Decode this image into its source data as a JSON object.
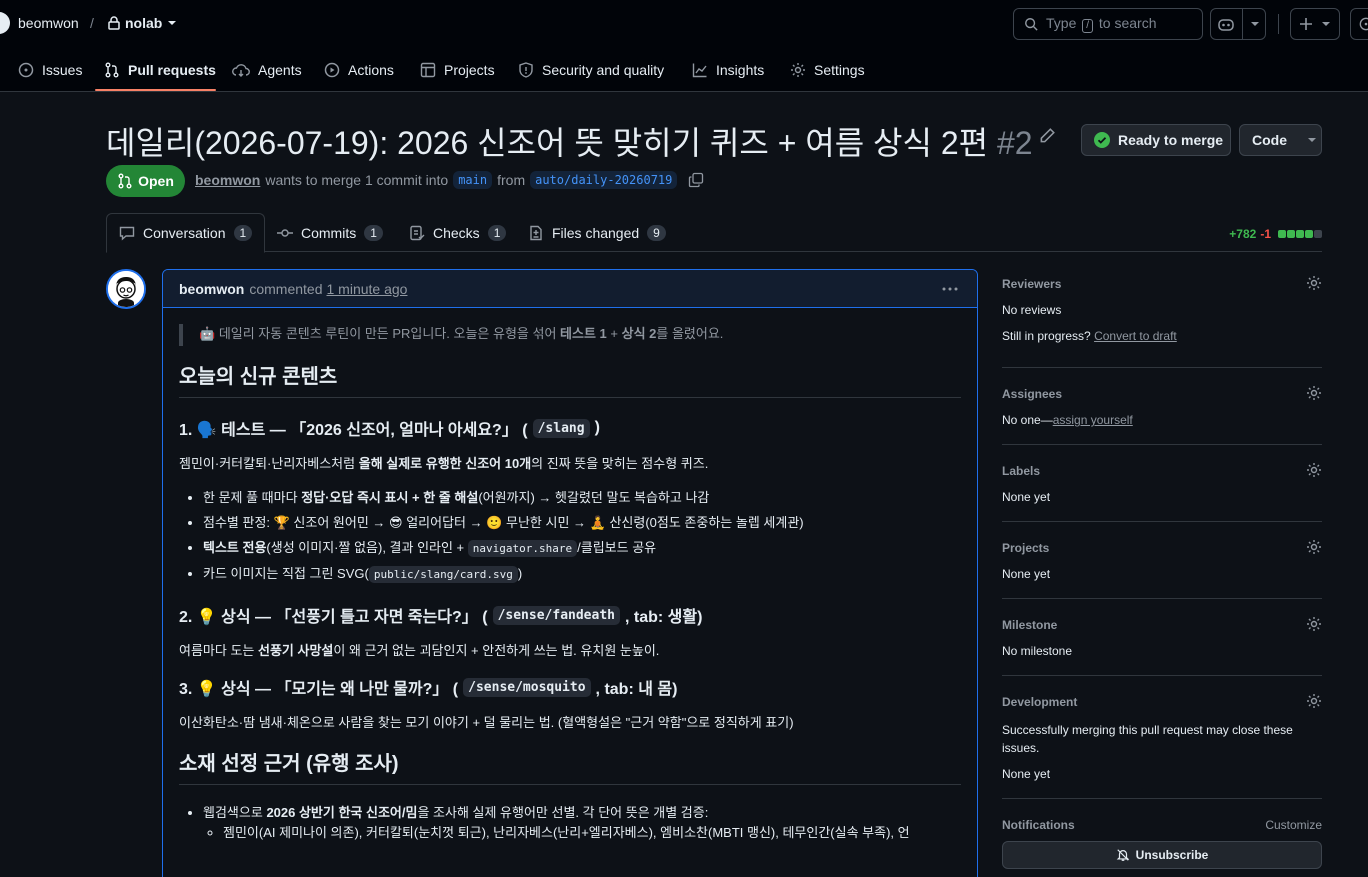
{
  "header": {
    "owner": "beomwon",
    "separator": "/",
    "repo": "nolab",
    "search_prefix": "Type",
    "search_key": "/",
    "search_suffix": "to search"
  },
  "nav": [
    {
      "label": "Issues",
      "icon": "issue-icon"
    },
    {
      "label": "Pull requests",
      "icon": "pull-request-icon",
      "active": true
    },
    {
      "label": "Agents",
      "icon": "agents-icon"
    },
    {
      "label": "Actions",
      "icon": "play-icon"
    },
    {
      "label": "Projects",
      "icon": "table-icon"
    },
    {
      "label": "Security and quality",
      "icon": "shield-icon"
    },
    {
      "label": "Insights",
      "icon": "graph-icon"
    },
    {
      "label": "Settings",
      "icon": "gear-icon"
    }
  ],
  "pr": {
    "title": "데일리(2026-07-19): 2026 신조어 뜻 맞히기 퀴즈 + 여름 상식 2편",
    "number": "#2",
    "state": "Open",
    "author": "beomwon",
    "meta_text": "wants to merge 1 commit into",
    "base": "main",
    "from": "from",
    "head": "auto/daily-20260719",
    "merge_label": "Ready to merge",
    "code_label": "Code"
  },
  "tabs": [
    {
      "label": "Conversation",
      "count": "1"
    },
    {
      "label": "Commits",
      "count": "1"
    },
    {
      "label": "Checks",
      "count": "1"
    },
    {
      "label": "Files changed",
      "count": "9"
    }
  ],
  "diffstat": {
    "additions": "+782",
    "deletions": "-1"
  },
  "comment": {
    "author": "beomwon",
    "action": "commented",
    "time": "1 minute ago",
    "quote_emoji": "🤖",
    "quote_a": "데일리 자동 콘텐츠 루틴이 만든 PR입니다. 오늘은 유형을 섞어",
    "quote_b": "테스트 1",
    "quote_c": "+",
    "quote_d": "상식 2",
    "quote_e": "를 올렸어요.",
    "h2_new": "오늘의 신규 콘텐츠",
    "s1": {
      "title_a": "1. 🗣️ 테스트 — 「2026 신조어, 얼마나 아세요?」 (",
      "code": "/slang",
      "title_b": ")",
      "p_a": "젬민이·커터칼퇴·난리자베스처럼",
      "p_b": "올해 실제로 유행한 신조어 10개",
      "p_c": "의 진짜 뜻을 맞히는 점수형 퀴즈.",
      "li1_a": "한 문제 풀 때마다",
      "li1_b": "정답·오답 즉시 표시 + 한 줄 해설",
      "li1_c": "(어원까지) → 헷갈렸던 말도 복습하고 나감",
      "li2": "점수별 판정: 🏆 신조어 원어민 → 😎 얼리어답터 → 🙂 무난한 시민 → 🧘 산신령(0점도 존중하는 놀렙 세계관)",
      "li3_a": "텍스트 전용",
      "li3_b": "(생성 이미지·짤 없음), 결과 인라인 +",
      "li3_code": "navigator.share",
      "li3_c": "/클립보드 공유",
      "li4_a": "카드 이미지는 직접 그린 SVG(",
      "li4_code": "public/slang/card.svg",
      "li4_b": ")"
    },
    "s2": {
      "title_a": "2. 💡 상식 — 「선풍기 틀고 자면 죽는다?」 (",
      "code": "/sense/fandeath",
      "title_b": ", tab: 생활)",
      "p_a": "여름마다 도는",
      "p_b": "선풍기 사망설",
      "p_c": "이 왜 근거 없는 괴담인지 + 안전하게 쓰는 법. 유치원 눈높이."
    },
    "s3": {
      "title_a": "3. 💡 상식 — 「모기는 왜 나만 물까?」 (",
      "code": "/sense/mosquito",
      "title_b": ", tab: 내 몸)",
      "p": "이산화탄소·땀 냄새·체온으로 사람을 찾는 모기 이야기 + 덜 물리는 법. (혈액형설은 \"근거 약함\"으로 정직하게 표기)"
    },
    "h2_basis": "소재 선정 근거 (유행 조사)",
    "basis_li_a": "웹검색으로",
    "basis_li_b": "2026 상반기 한국 신조어/밈",
    "basis_li_c": "을 조사해 실제 유행어만 선별. 각 단어 뜻은 개별 검증:",
    "basis_sub": "젬민이(AI 제미나이 의존), 커터칼퇴(눈치껏 퇴근), 난리자베스(난리+엘리자베스), 엠비소찬(MBTI 맹신), 테무인간(실속 부족), 언"
  },
  "sidebar": {
    "reviewers_title": "Reviewers",
    "reviewers_text": "No reviews",
    "progress_text": "Still in progress?",
    "draft_link": "Convert to draft",
    "assignees_title": "Assignees",
    "assignees_text": "No one—",
    "assign_link": "assign yourself",
    "labels_title": "Labels",
    "labels_text": "None yet",
    "projects_title": "Projects",
    "projects_text": "None yet",
    "milestone_title": "Milestone",
    "milestone_text": "No milestone",
    "dev_title": "Development",
    "dev_text": "Successfully merging this pull request may close these issues.",
    "dev_none": "None yet",
    "notif_title": "Notifications",
    "customize": "Customize",
    "unsubscribe": "Unsubscribe"
  },
  "colors": {
    "accent": "#1f6feb",
    "open": "#238636",
    "tab_underline": "#f78166",
    "add": "#3fb950",
    "del": "#f85149"
  }
}
